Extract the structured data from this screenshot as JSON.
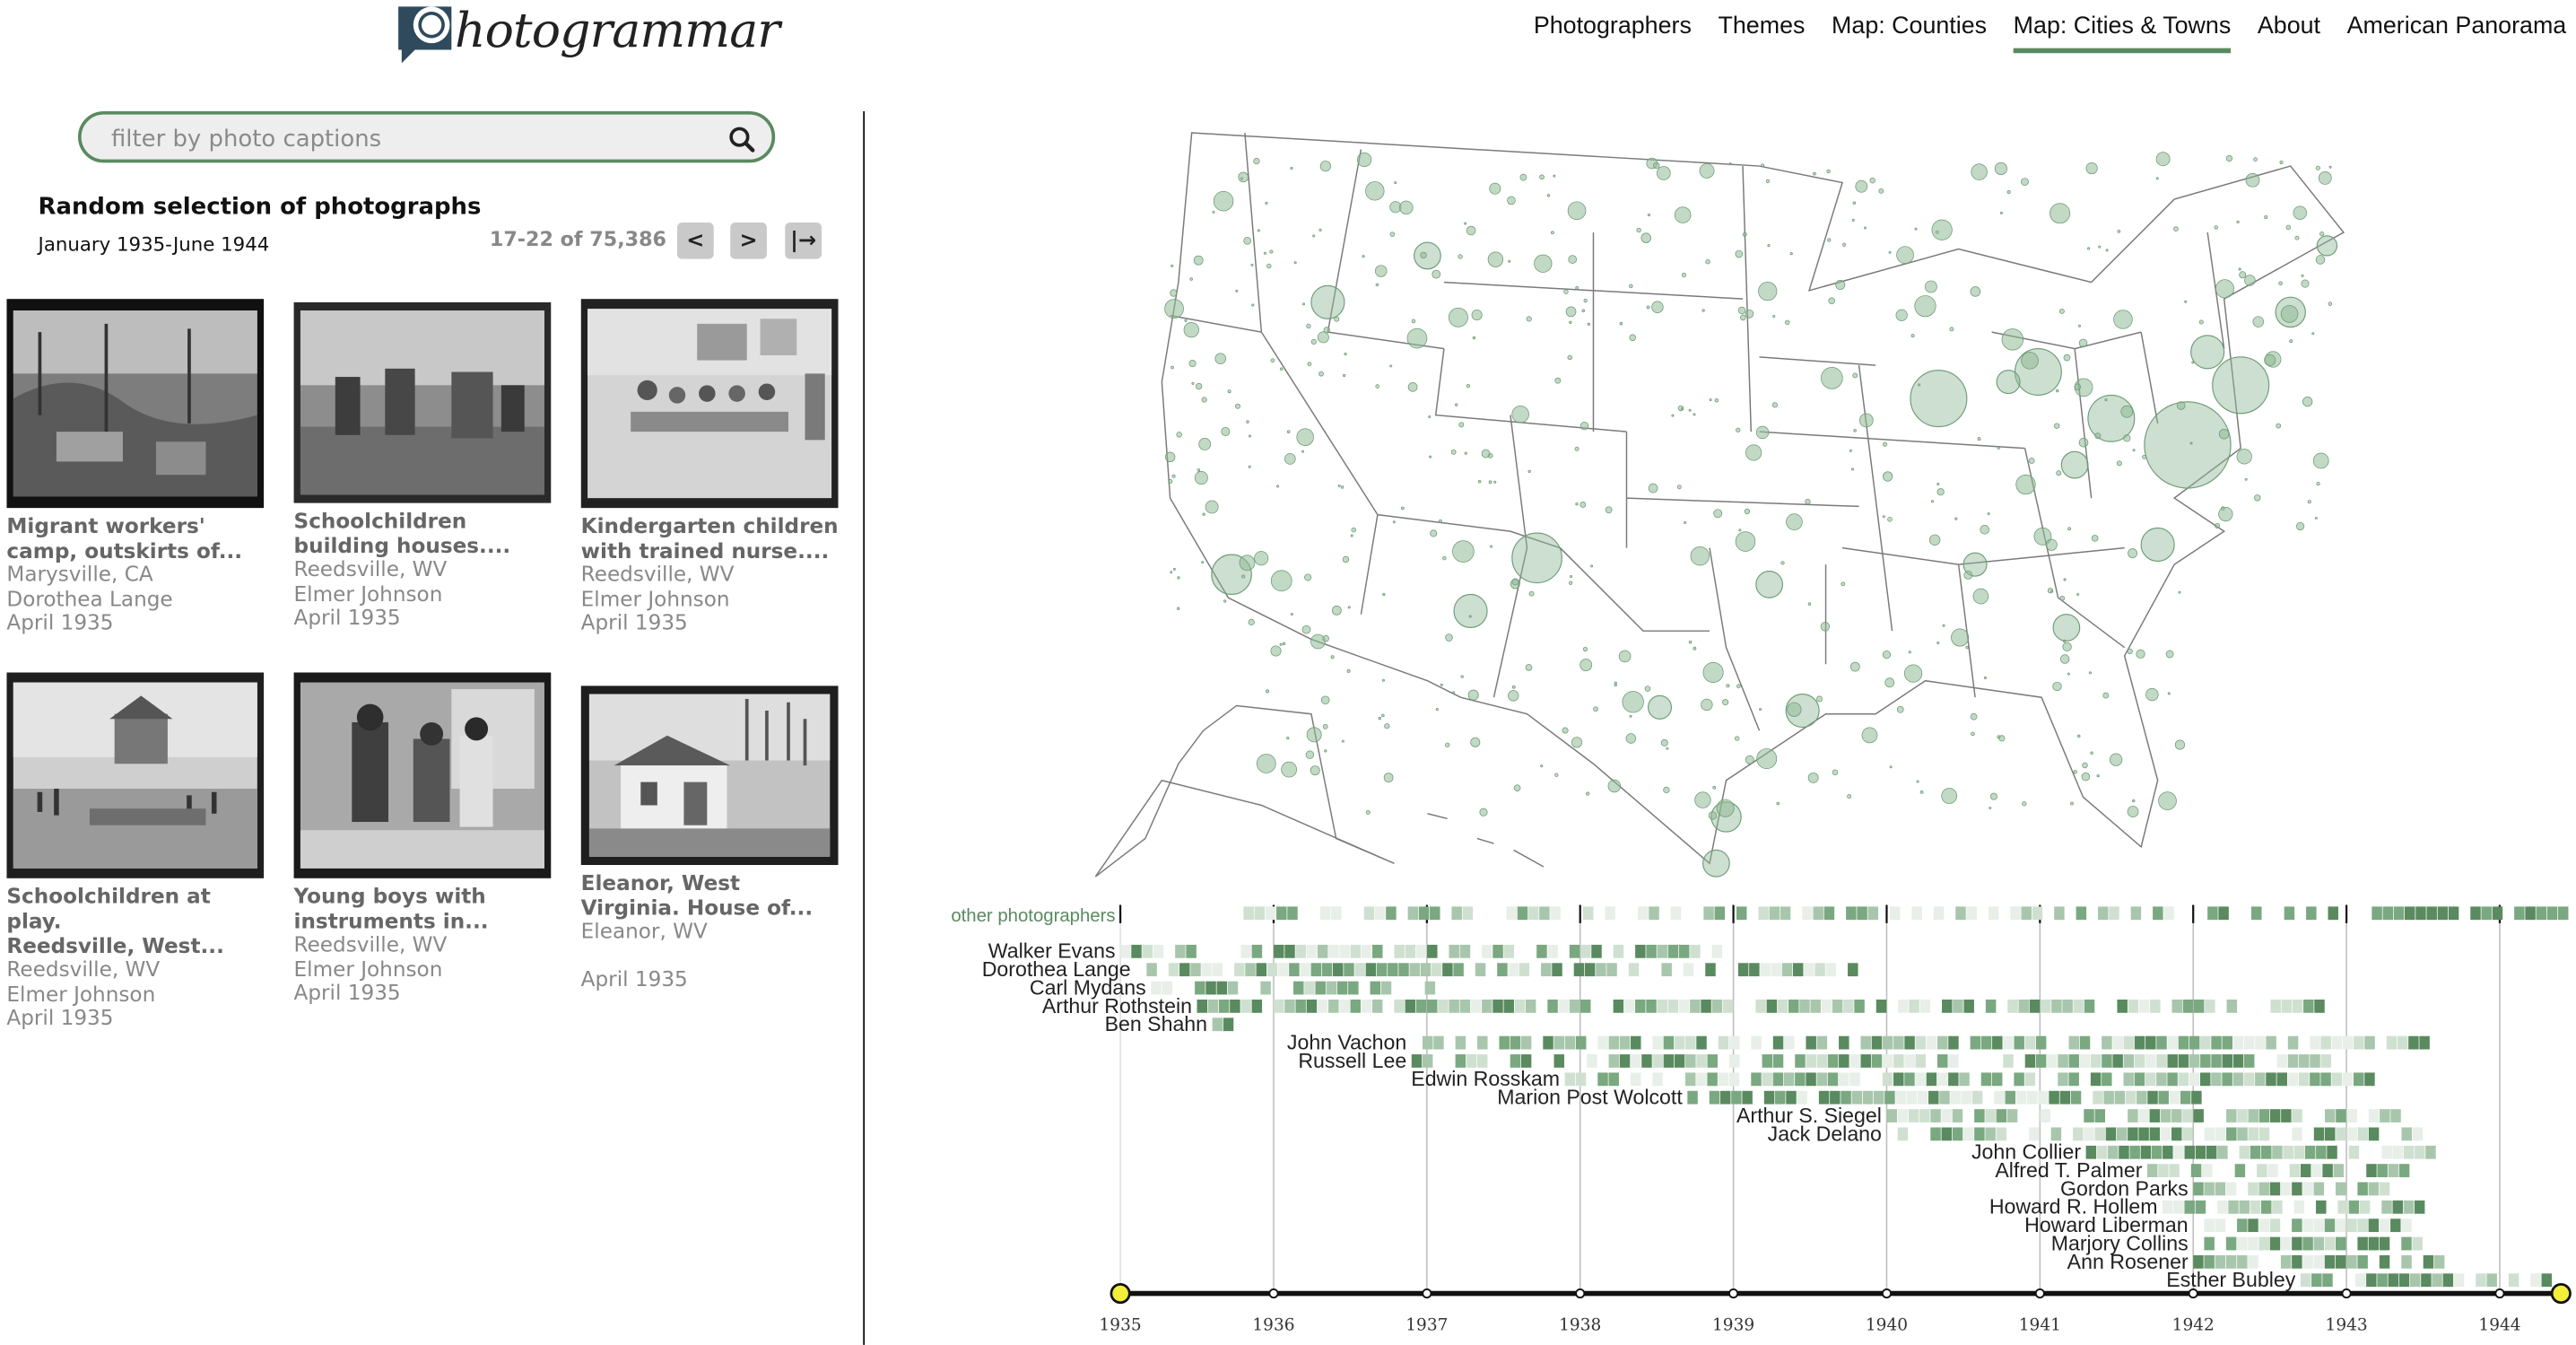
{
  "brand": {
    "name": "hotogrammar"
  },
  "nav": [
    {
      "label": "Photographers",
      "active": false
    },
    {
      "label": "Themes",
      "active": false
    },
    {
      "label": "Map: Counties",
      "active": false
    },
    {
      "label": "Map: Cities & Towns",
      "active": true
    },
    {
      "label": "About",
      "active": false
    },
    {
      "label": "American Panorama",
      "active": false
    }
  ],
  "search": {
    "placeholder": "filter by photo captions",
    "value": "",
    "icon": "search-icon"
  },
  "selection": {
    "title": "Random selection of photographs",
    "range": "January 1935-June 1944",
    "count": "17-22 of 75,386",
    "prev_label": "<",
    "next_label": ">",
    "last_label": "|→"
  },
  "photos": [
    {
      "caption1": "Migrant workers'",
      "caption2": "camp, outskirts of...",
      "place": "Marysville, CA",
      "photographer": "Dorothea Lange",
      "date": "April 1935"
    },
    {
      "caption1": "Schoolchildren",
      "caption2": "building houses....",
      "place": "Reedsville, WV",
      "photographer": "Elmer Johnson",
      "date": "April 1935"
    },
    {
      "caption1": "Kindergarten children",
      "caption2": "with trained nurse....",
      "place": "Reedsville, WV",
      "photographer": "Elmer Johnson",
      "date": "April 1935"
    },
    {
      "caption1": "Schoolchildren at play.",
      "caption2": "Reedsville, West...",
      "place": "Reedsville, WV",
      "photographer": "Elmer Johnson",
      "date": "April 1935"
    },
    {
      "caption1": "Young boys with",
      "caption2": "instruments in...",
      "place": "Reedsville, WV",
      "photographer": "Elmer Johnson",
      "date": "April 1935"
    },
    {
      "caption1": "Eleanor, West",
      "caption2": "Virginia. House of...",
      "place": "Eleanor, WV",
      "photographer": "",
      "date": "April 1935"
    }
  ],
  "timeline": {
    "other_label": "other photographers",
    "photographers": [
      {
        "name": "Walker Evans",
        "start": 1935.0,
        "end": 1938.9
      },
      {
        "name": "Dorothea Lange",
        "start": 1935.1,
        "end": 1939.8
      },
      {
        "name": "Carl Mydans",
        "start": 1935.2,
        "end": 1937.1
      },
      {
        "name": "Arthur Rothstein",
        "start": 1935.5,
        "end": 1942.8
      },
      {
        "name": "Ben Shahn",
        "start": 1935.6,
        "end": 1935.8
      },
      {
        "name": "John Vachon",
        "start": 1936.9,
        "end": 1943.5
      },
      {
        "name": "Russell Lee",
        "start": 1936.9,
        "end": 1942.9
      },
      {
        "name": "Edwin Rosskam",
        "start": 1937.9,
        "end": 1943.2
      },
      {
        "name": "Marion Post Wolcott",
        "start": 1938.7,
        "end": 1942.0
      },
      {
        "name": "Arthur S. Siegel",
        "start": 1940.0,
        "end": 1943.3
      },
      {
        "name": "Jack Delano",
        "start": 1940.0,
        "end": 1943.6
      },
      {
        "name": "John Collier",
        "start": 1941.3,
        "end": 1943.6
      },
      {
        "name": "Alfred T. Palmer",
        "start": 1941.7,
        "end": 1943.4
      },
      {
        "name": "Gordon Parks",
        "start": 1942.0,
        "end": 1943.5
      },
      {
        "name": "Howard R. Hollem",
        "start": 1941.8,
        "end": 1943.5
      },
      {
        "name": "Howard Liberman",
        "start": 1942.0,
        "end": 1943.4
      },
      {
        "name": "Marjory Collins",
        "start": 1942.0,
        "end": 1943.5
      },
      {
        "name": "Ann Rosener",
        "start": 1942.0,
        "end": 1943.6
      },
      {
        "name": "Esther Bubley",
        "start": 1942.7,
        "end": 1944.3
      }
    ],
    "years": [
      "1935",
      "1936",
      "1937",
      "1938",
      "1939",
      "1940",
      "1941",
      "1942",
      "1943",
      "1944"
    ],
    "range_start": 1935.0,
    "range_end": 1944.4
  },
  "colors": {
    "accent": "#5a8a5f",
    "bubble": "#8fb996",
    "handle": "#f2ee3a"
  }
}
